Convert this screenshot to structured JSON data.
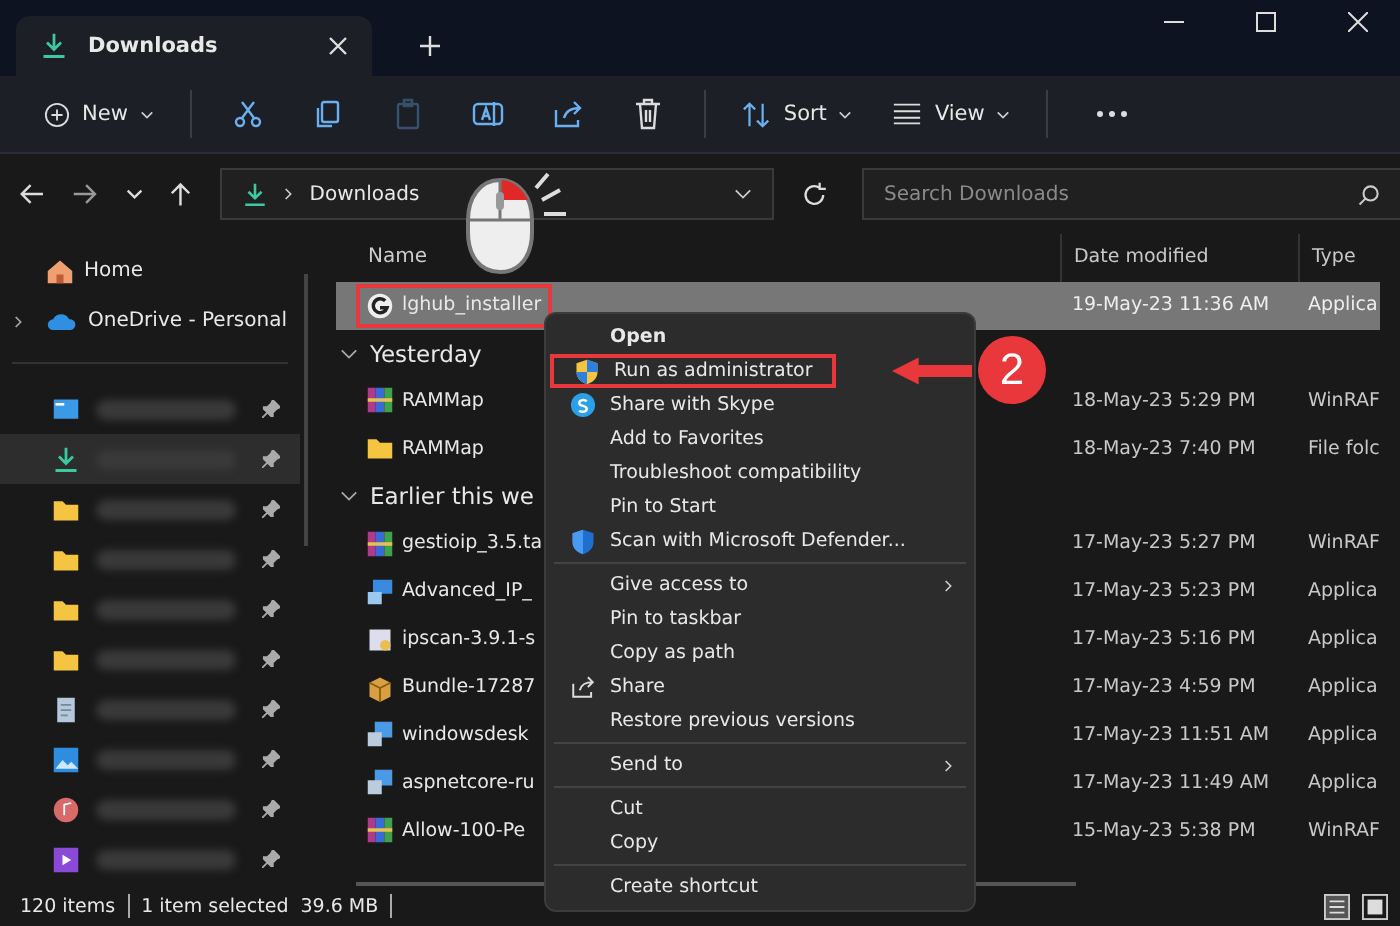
{
  "window": {
    "tab_title": "Downloads"
  },
  "toolbar": {
    "new_label": "New",
    "actions": [
      {
        "kind": "cut",
        "disabled": false
      },
      {
        "kind": "copy",
        "disabled": false
      },
      {
        "kind": "paste",
        "disabled": true
      },
      {
        "kind": "rename",
        "disabled": false
      },
      {
        "kind": "share",
        "disabled": false
      },
      {
        "kind": "delete",
        "disabled": false
      }
    ],
    "sort_label": "Sort",
    "view_label": "View"
  },
  "address": {
    "path": "Downloads",
    "search_placeholder": "Search Downloads"
  },
  "sidebar": {
    "items": [
      {
        "label": "Home",
        "kind": "home",
        "expandable": false
      },
      {
        "label": "OneDrive - Personal",
        "kind": "cloud",
        "expandable": true
      }
    ],
    "pinned": [
      {
        "kind": "desktop",
        "selected": false
      },
      {
        "kind": "download",
        "selected": true
      },
      {
        "kind": "folder",
        "selected": false
      },
      {
        "kind": "folder",
        "selected": false
      },
      {
        "kind": "folder",
        "selected": false
      },
      {
        "kind": "folder",
        "selected": false
      },
      {
        "kind": "document",
        "selected": false
      },
      {
        "kind": "pictures",
        "selected": false
      },
      {
        "kind": "music",
        "selected": false
      },
      {
        "kind": "videos",
        "selected": false
      }
    ]
  },
  "columns": [
    "Name",
    "Date modified",
    "Type"
  ],
  "rows": [
    {
      "kind": "logo-app",
      "name": "lghub_installer",
      "date": "19-May-23 11:36 AM",
      "type": "Applica",
      "selected": true,
      "marked": true
    },
    {
      "kind": "group",
      "label": "Yesterday"
    },
    {
      "kind": "archive",
      "name": "RAMMap",
      "date": "18-May-23 5:29 PM",
      "type": "WinRAF",
      "selected": false,
      "marked": false
    },
    {
      "kind": "folder",
      "name": "RAMMap",
      "date": "18-May-23 7:40 PM",
      "type": "File folc",
      "selected": false,
      "marked": false
    },
    {
      "kind": "group",
      "label": "Earlier this we"
    },
    {
      "kind": "archive",
      "name": "gestioip_3.5.ta",
      "date": "17-May-23 5:27 PM",
      "type": "WinRAF",
      "selected": false,
      "marked": false
    },
    {
      "kind": "network",
      "name": "Advanced_IP_",
      "date": "17-May-23 5:23 PM",
      "type": "Applica",
      "selected": false,
      "marked": false
    },
    {
      "kind": "app",
      "name": "ipscan-3.9.1-s",
      "date": "17-May-23 5:16 PM",
      "type": "Applica",
      "selected": false,
      "marked": false
    },
    {
      "kind": "box",
      "name": "Bundle-17287",
      "date": "17-May-23 4:59 PM",
      "type": "Applica",
      "selected": false,
      "marked": false
    },
    {
      "kind": "installer",
      "name": "windowsdesk",
      "date": "17-May-23 11:51 AM",
      "type": "Applica",
      "selected": false,
      "marked": false
    },
    {
      "kind": "installer",
      "name": "aspnetcore-ru",
      "date": "17-May-23 11:49 AM",
      "type": "Applica",
      "selected": false,
      "marked": false
    },
    {
      "kind": "archive",
      "name": "Allow-100-Pe",
      "date": "15-May-23 5:38 PM",
      "type": "WinRAF",
      "selected": false,
      "marked": false
    }
  ],
  "context_menu": [
    {
      "kind": "plain",
      "label": "Open",
      "default": true,
      "submenu": false,
      "marked": false
    },
    {
      "kind": "shield",
      "label": "Run as administrator",
      "default": false,
      "submenu": false,
      "marked": true
    },
    {
      "kind": "skype",
      "label": "Share with Skype",
      "default": false,
      "submenu": false,
      "marked": false
    },
    {
      "kind": "plain",
      "label": "Add to Favorites",
      "default": false,
      "submenu": false,
      "marked": false
    },
    {
      "kind": "plain",
      "label": "Troubleshoot compatibility",
      "default": false,
      "submenu": false,
      "marked": false
    },
    {
      "kind": "plain",
      "label": "Pin to Start",
      "default": false,
      "submenu": false,
      "marked": false
    },
    {
      "kind": "defender",
      "label": "Scan with Microsoft Defender...",
      "default": false,
      "submenu": false,
      "marked": false
    },
    {
      "kind": "separator"
    },
    {
      "kind": "plain",
      "label": "Give access to",
      "default": false,
      "submenu": true,
      "marked": false
    },
    {
      "kind": "plain",
      "label": "Pin to taskbar",
      "default": false,
      "submenu": false,
      "marked": false
    },
    {
      "kind": "plain",
      "label": "Copy as path",
      "default": false,
      "submenu": false,
      "marked": false
    },
    {
      "kind": "share",
      "label": "Share",
      "default": false,
      "submenu": false,
      "marked": false
    },
    {
      "kind": "plain",
      "label": "Restore previous versions",
      "default": false,
      "submenu": false,
      "marked": false
    },
    {
      "kind": "separator"
    },
    {
      "kind": "plain",
      "label": "Send to",
      "default": false,
      "submenu": true,
      "marked": false
    },
    {
      "kind": "separator"
    },
    {
      "kind": "plain",
      "label": "Cut",
      "default": false,
      "submenu": false,
      "marked": false
    },
    {
      "kind": "plain",
      "label": "Copy",
      "default": false,
      "submenu": false,
      "marked": false
    },
    {
      "kind": "separator"
    },
    {
      "kind": "plain",
      "label": "Create shortcut",
      "default": false,
      "submenu": false,
      "marked": false
    }
  ],
  "status_bar": {
    "count": "120 items",
    "selection": "1 item selected",
    "size": "39.6 MB"
  },
  "annotation": {
    "step": "2"
  }
}
